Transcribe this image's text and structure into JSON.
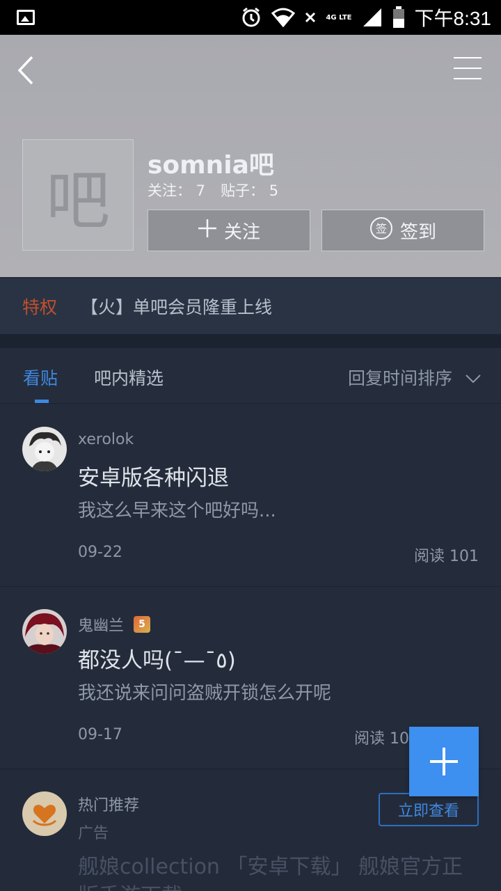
{
  "status_bar": {
    "network": "4G LTE",
    "time": "下午8:31",
    "icons": [
      "image-icon",
      "alarm-icon",
      "wifi-icon",
      "signal-icon",
      "battery-icon"
    ]
  },
  "header": {
    "forum_avatar_glyph": "吧",
    "forum_name": "somnia吧",
    "follow_count_label": "关注： 7",
    "post_count_label": "贴子： 5",
    "follow_button": "关注",
    "signin_button": "签到",
    "signin_icon_glyph": "签",
    "back_icon": "back-arrow-icon",
    "menu_icon": "menu-icon"
  },
  "privilege": {
    "tag": "特权",
    "text": "【火】单吧会员隆重上线"
  },
  "tabs": {
    "items": [
      {
        "label": "看贴",
        "active": true
      },
      {
        "label": "吧内精选",
        "active": false
      }
    ],
    "sort_label": "回复时间排序"
  },
  "posts": [
    {
      "author": "xerolok",
      "title": "安卓版各种闪退",
      "excerpt": "我这么早来这个吧好吗...",
      "date": "09-22",
      "reads": "阅读 101"
    },
    {
      "author": "鬼幽兰",
      "level_badge": "5",
      "title": "都没人吗(¯—¯٥)",
      "excerpt": "我还说来问问盗贼开锁怎么开呢",
      "date": "09-17",
      "reads": "阅读 10"
    }
  ],
  "ad": {
    "label": "热门推荐",
    "sub_label": "广告",
    "button": "立即查看",
    "text": "舰娘collection 「安卓下载」 舰娘官方正版手游下载"
  },
  "colors": {
    "accent": "#3f88e0",
    "privilege": "#c0502c",
    "background": "#232b3a",
    "header": "#ababb0",
    "fab": "#3d8ff0"
  }
}
